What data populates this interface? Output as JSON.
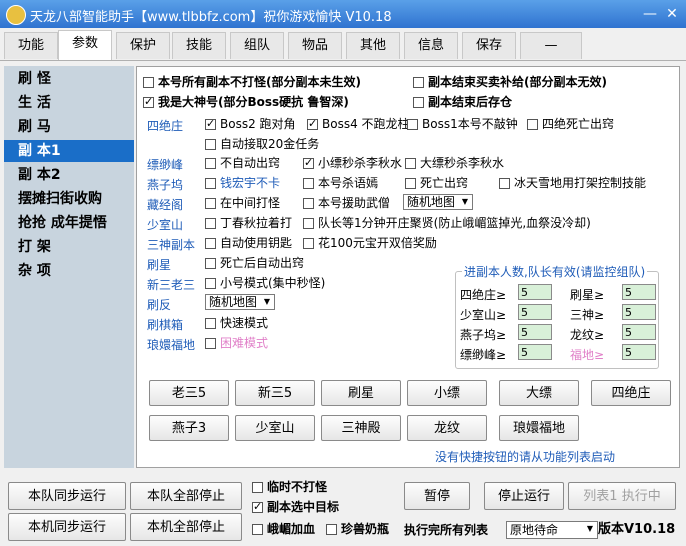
{
  "window": {
    "title": "天龙八部智能助手【www.tlbbfz.com】祝你游戏愉快 V10.18",
    "minimize": "—",
    "close": "✕"
  },
  "tabs": [
    "功能",
    "参数",
    "保护",
    "技能",
    "组队",
    "物品",
    "其他",
    "信息",
    "保存",
    "—"
  ],
  "sidebar": [
    "刷 怪",
    "生 活",
    "刷 马",
    "副 本1",
    "副 本2",
    "摆摊扫街收购",
    "抢抢 成年提悟",
    "打 架",
    "杂 项"
  ],
  "top_options": {
    "no_fight": "本号所有副本不打怪(部分副本未生效)",
    "buy_supply": "副本结束买卖补给(部分副本无效)",
    "big_god": "我是大神号(部分Boss硬抗 鲁智深)",
    "store_after": "副本结束后存仓"
  },
  "sections": {
    "sijuezhuang": {
      "label": "四绝庄",
      "boss2": "Boss2 跑对角",
      "boss4": "Boss4 不跑龙柱",
      "boss1": "Boss1本号不敲钟",
      "sijue_dead": "四绝死亡出窍",
      "accept20": "自动接取20金任务"
    },
    "piaomiao": {
      "label": "缥缈峰",
      "no_dead": "不自动出窍",
      "xiaopiao": "小缥秒杀李秋水",
      "dapiao": "大缥秒杀李秋水"
    },
    "yanziwu": {
      "label": "燕子坞",
      "qian": "钱宏宇不卡",
      "murong": "本号杀语嫣",
      "death": "死亡出窍",
      "bing": "冰天雪地用打架控制技能"
    },
    "cangjingge": {
      "label": "藏经阁",
      "middle": "在中间打怪",
      "help": "本号援助武僧",
      "map": "随机地图"
    },
    "shaoshi": {
      "label": "少室山",
      "ding": "丁春秋拉着打",
      "leader": "队长等1分钟开庄聚贤(防止峨嵋篮掉光,血祭没冷却)"
    },
    "sanshen": {
      "label": "三神副本",
      "key": "自动使用钥匙",
      "flower": "花100元宝开双倍奖励"
    },
    "shuaxing": {
      "label": "刷星",
      "death": "死亡后自动出窍"
    },
    "xinsan": {
      "label": "新三老三",
      "small": "小号模式(集中秒怪)"
    },
    "shuafan": {
      "label": "刷反",
      "map": "随机地图"
    },
    "shuaqi": {
      "label": "刷棋箱",
      "fast": "快速模式"
    },
    "langhuan": {
      "label": "琅嬛福地",
      "hard": "困难模式"
    }
  },
  "group": {
    "legend": "进副本人数,队长有效(请监控组队)",
    "left": [
      {
        "label": "四绝庄≥",
        "value": "5"
      },
      {
        "label": "少室山≥",
        "value": "5"
      },
      {
        "label": "燕子坞≥",
        "value": "5"
      },
      {
        "label": "缥缈峰≥",
        "value": "5"
      }
    ],
    "right": [
      {
        "label": "刷星≥",
        "value": "5"
      },
      {
        "label": "三神≥",
        "value": "5"
      },
      {
        "label": "龙纹≥",
        "value": "5"
      },
      {
        "label": "福地≥",
        "value": "5"
      }
    ]
  },
  "quick_buttons": [
    "老三5",
    "新三5",
    "刷星",
    "小缥",
    "大缥",
    "四绝庄",
    "燕子3",
    "少室山",
    "三神殿",
    "龙纹",
    "琅嬛福地"
  ],
  "hint": "没有快捷按钮的请从功能列表启动",
  "bottom": {
    "team_sync": "本队同步运行",
    "team_stop": "本队全部停止",
    "local_sync": "本机同步运行",
    "local_stop": "本机全部停止",
    "temp_no_fight": "临时不打怪",
    "select_target": "副本选中目标",
    "emei_blood": "峨嵋加血",
    "zhenshou": "珍兽奶瓶",
    "pause": "暂停",
    "stop": "停止运行",
    "list_run": "列表1 执行中",
    "after_list": "执行完所有列表",
    "after_select": "原地待命",
    "version": "版本V10.18"
  },
  "colors": {
    "accent": "#1a6ec8",
    "section": "#1f5cb8",
    "numbox": "#d8f0d8",
    "pink": "#e080c8"
  }
}
